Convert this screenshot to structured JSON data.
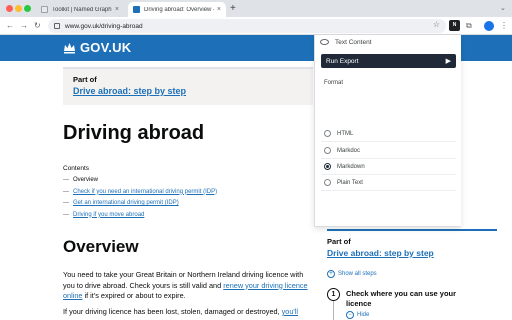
{
  "browser": {
    "tabs": [
      {
        "title": "Toolkit | Named Graph",
        "active": false
      },
      {
        "title": "Driving abroad: Overview - G",
        "active": true
      }
    ],
    "new_tab_icon": "plus-icon",
    "url": "www.gov.uk/driving-abroad",
    "extension_badge": "N"
  },
  "page": {
    "brand": "GOV.UK",
    "part_of": {
      "label": "Part of",
      "link": "Drive abroad: step by step"
    },
    "title": "Driving abroad",
    "contents_title": "Contents",
    "contents": [
      {
        "text": "Overview",
        "link": false
      },
      {
        "text": "Check if you need an international driving permit (IDP)",
        "link": true
      },
      {
        "text": "Get an international driving permit (IDP)",
        "link": true
      },
      {
        "text": "Driving if you move abroad",
        "link": true
      }
    ],
    "overview_heading": "Overview",
    "para1": {
      "pre": "You need to take your Great Britain or Northern Ireland driving licence with you to drive abroad. Check yours is still valid and ",
      "link": "renew your driving licence online",
      "post": " if it's expired or about to expire."
    },
    "para2": {
      "pre": "If your driving licence has been lost, stolen, damaged or destroyed, ",
      "link": "you'll"
    },
    "sidebar": {
      "part_of": "Part of",
      "link": "Drive abroad: step by step",
      "show_all": "Show all steps",
      "step_number": "1",
      "step_title": "Check where you can use your licence",
      "hide": "Hide"
    }
  },
  "popup": {
    "header": "Text Content",
    "run_button": "Run Export",
    "format_label": "Format",
    "options": [
      {
        "label": "HTML",
        "selected": false
      },
      {
        "label": "Markdoc",
        "selected": false
      },
      {
        "label": "Markdown",
        "selected": true
      },
      {
        "label": "Plain Text",
        "selected": false
      }
    ]
  }
}
